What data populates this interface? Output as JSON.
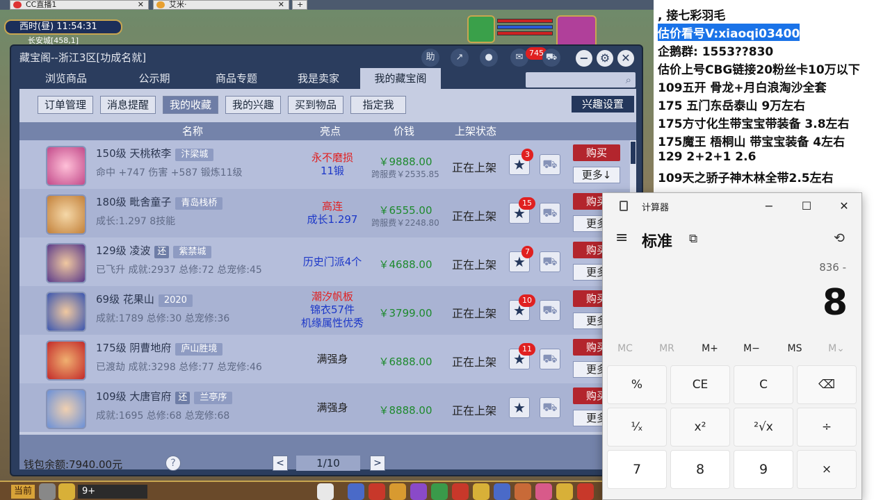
{
  "browser_tabs": [
    {
      "label": "CC直播1"
    },
    {
      "label": "艾米·"
    }
  ],
  "game": {
    "clock": "西时(昼)   11:54:31",
    "location": "长安城[458,1]",
    "channel": "当前",
    "chat_input": "9+"
  },
  "window": {
    "title": "藏宝阁--浙江3区[功成名就]",
    "help_label": "助",
    "notify_count": "745",
    "main_tabs": [
      "浏览商品",
      "公示期",
      "商品专题",
      "我是卖家",
      "我的藏宝阁"
    ],
    "sub_tabs": [
      "订单管理",
      "消息提醒",
      "我的收藏",
      "我的兴趣",
      "买到物品",
      "指定我"
    ],
    "interest_settings": "兴趣设置",
    "columns": {
      "name": "名称",
      "highlight": "亮点",
      "price": "价钱",
      "status": "上架状态"
    },
    "buy_label": "购买",
    "more_label": "更多",
    "rows": [
      {
        "title": "150级  天桃秾李",
        "server": "汴梁城",
        "flag": "",
        "sub": "命中 +747  伤害 +587  锻炼11级",
        "hl1": "永不磨损",
        "hl1_color": "red",
        "hl2": "11锻",
        "hl2_color": "blue",
        "hl3": "",
        "price": "￥9888.00",
        "fee": "跨服费￥2535.85",
        "status": "正在上架",
        "fav": "3",
        "more": "更多↓"
      },
      {
        "title": "180级  毗舍童子",
        "server": "青岛栈桥",
        "flag": "",
        "sub": "成长:1.297  8技能",
        "hl1": "高连",
        "hl1_color": "red",
        "hl2": "成长1.297",
        "hl2_color": "blue",
        "hl3": "",
        "price": "￥6555.00",
        "fee": "跨服费￥2248.80",
        "status": "正在上架",
        "fav": "15",
        "more": "更多"
      },
      {
        "title": "129级  凌波",
        "server": "紫禁城",
        "flag": "还",
        "sub": "已飞升  成就:2937  总修:72  总宠修:45",
        "hl1": "历史门派4个",
        "hl1_color": "blue",
        "hl2": "",
        "hl2_color": "blue",
        "hl3": "",
        "price": "￥4688.00",
        "fee": "",
        "status": "正在上架",
        "fav": "7",
        "more": "更多"
      },
      {
        "title": "69级  花果山",
        "server": "2020",
        "flag": "",
        "sub": "成就:1789  总修:30  总宠修:36",
        "hl1": "潮汐帆板",
        "hl1_color": "red",
        "hl2": "锦衣57件",
        "hl2_color": "blue",
        "hl3": "机缘属性优秀",
        "price": "￥3799.00",
        "fee": "",
        "status": "正在上架",
        "fav": "10",
        "more": "更多"
      },
      {
        "title": "175级  阴曹地府",
        "server": "庐山胜境",
        "flag": "",
        "sub": "已渡劫  成就:3298  总修:77  总宠修:46",
        "hl1": "满强身",
        "hl1_color": "dark",
        "hl2": "",
        "hl2_color": "blue",
        "hl3": "",
        "price": "￥6888.00",
        "fee": "",
        "status": "正在上架",
        "fav": "11",
        "more": "更多"
      },
      {
        "title": "109级  大唐官府",
        "server": "兰亭序",
        "flag": "还",
        "sub": "成就:1695  总修:68  总宠修:68",
        "hl1": "满强身",
        "hl1_color": "dark",
        "hl2": "",
        "hl2_color": "blue",
        "hl3": "",
        "price": "￥8888.00",
        "fee": "",
        "status": "正在上架",
        "fav": "",
        "more": "更多"
      }
    ],
    "wallet": "钱包余额:7940.00元",
    "help": "?",
    "page": "1/10",
    "prev": "<",
    "next": ">"
  },
  "notes": {
    "lines": [
      ",     接七彩羽毛",
      "估价看号V:xiaoqi03400",
      "企鹅群: 1553??830",
      "估价上号CBG链接20粉丝卡10万以下",
      "109五开 骨龙+月白浪淘沙全套",
      "175 五门东岳泰山  9万左右",
      "175方寸化生带宝宝带装备  3.8左右",
      "175魔王 梧桐山  带宝宝装备 4左右",
      "129 2+2+1  2.6",
      "109天之骄子神木林全带2.5左右"
    ]
  },
  "calculator": {
    "title": "计算器",
    "mode": "标准",
    "expression": "836 -",
    "display": "8",
    "memory": [
      "MC",
      "MR",
      "M+",
      "M−",
      "MS",
      "M⌄"
    ],
    "keys_row1": [
      "%",
      "CE",
      "C",
      "⌫"
    ],
    "keys_row2": [
      "¹⁄ₓ",
      "x²",
      "²√x",
      "÷"
    ],
    "keys_row3": [
      "7",
      "8",
      "9",
      "×"
    ]
  }
}
